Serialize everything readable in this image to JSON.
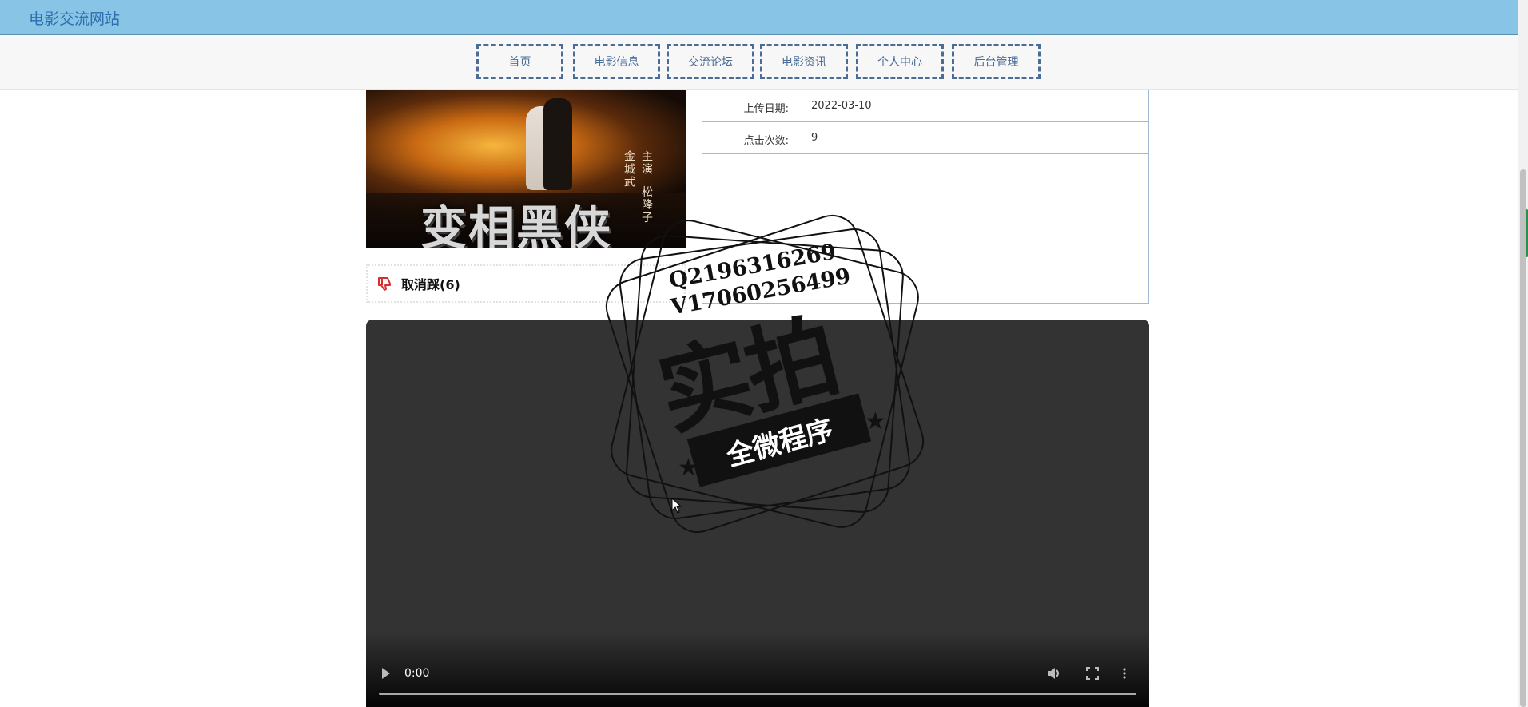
{
  "header": {
    "site_title": "电影交流网站"
  },
  "nav": {
    "items": [
      {
        "label": "首页"
      },
      {
        "label": "电影信息"
      },
      {
        "label": "交流论坛"
      },
      {
        "label": "电影资讯"
      },
      {
        "label": "个人中心"
      },
      {
        "label": "后台管理"
      }
    ]
  },
  "movie": {
    "poster_title": "变相黑侠",
    "poster_cast": "主演  松隆子\n金城武",
    "upload_date_label": "上传日期:",
    "upload_date": "2022-03-10",
    "clicks_label": "点击次数:",
    "clicks": "9",
    "dislike_label": "取消踩(6)"
  },
  "video": {
    "time": "0:00",
    "progress": 0
  },
  "watermark": {
    "line1": "Q2196316269",
    "line2": "V17060256499",
    "big": "实拍",
    "ribbon": "全微程序"
  },
  "colors": {
    "header_bg": "#87c4e6",
    "nav_border": "#4a6c96",
    "video_bg": "#333333",
    "dislike_icon": "#d9302f"
  },
  "icons": {
    "dislike": "thumbs-down-icon",
    "play": "play-icon",
    "volume": "volume-icon",
    "fullscreen": "fullscreen-icon",
    "more": "more-vertical-icon"
  }
}
